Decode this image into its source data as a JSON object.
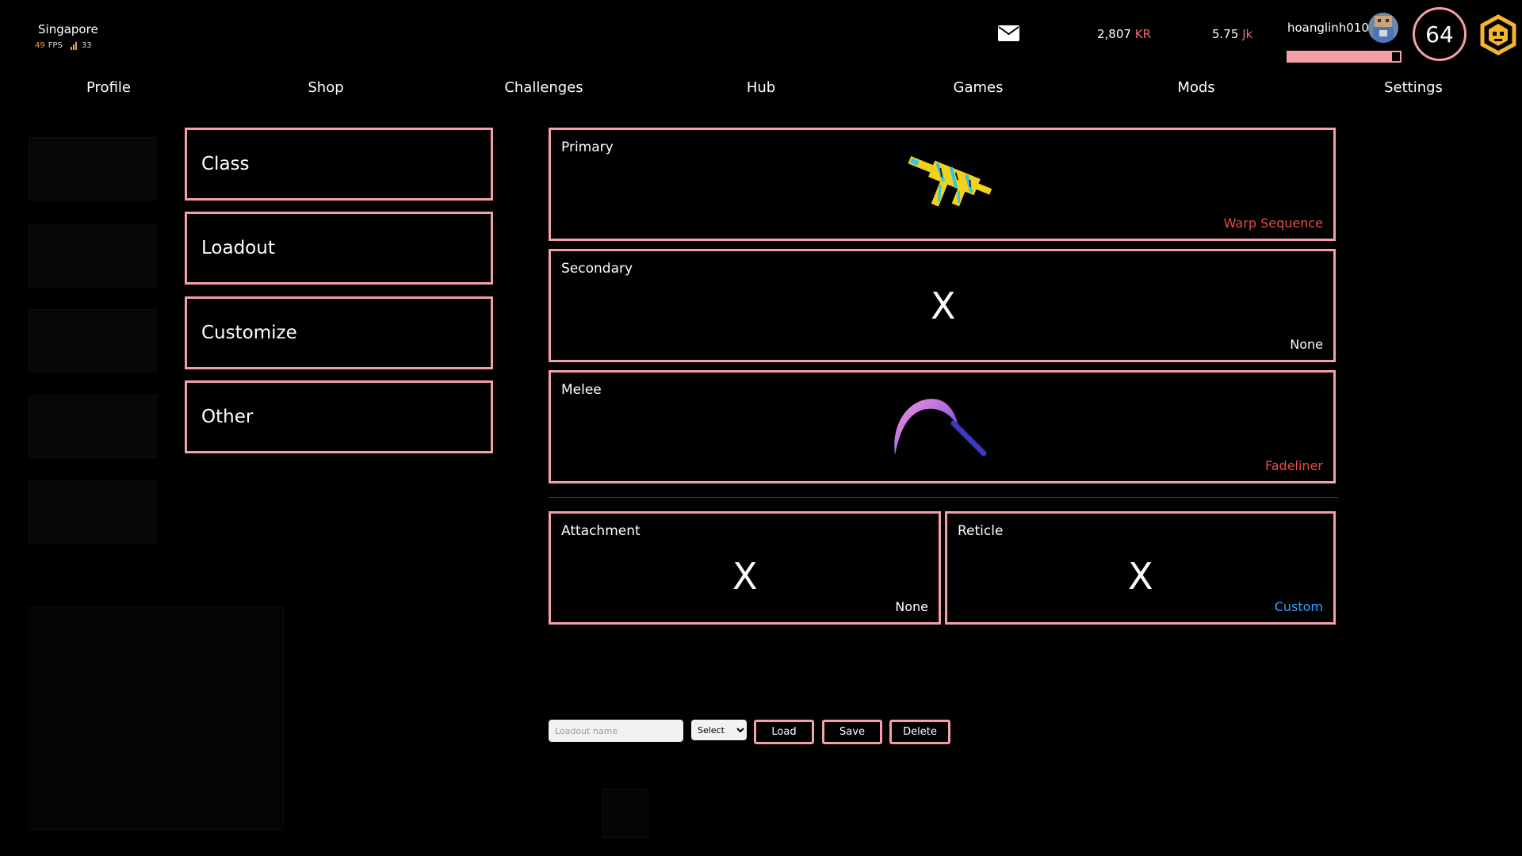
{
  "status": {
    "region": "Singapore",
    "fps": "49",
    "fps_label": "FPS",
    "ping": "33"
  },
  "header": {
    "kr_amount": "2,807",
    "kr_unit": "KR",
    "jk_amount": "5.75",
    "jk_unit": "Jk",
    "username": "hoanglinh0109",
    "level": "64",
    "xp_progress": 0.93
  },
  "nav": [
    "Profile",
    "Shop",
    "Challenges",
    "Hub",
    "Games",
    "Mods",
    "Settings"
  ],
  "menu": [
    "Class",
    "Loadout",
    "Customize",
    "Other"
  ],
  "slots": {
    "primary": {
      "label": "Primary",
      "item": "Warp Sequence",
      "item_color": "#e84a4a"
    },
    "secondary": {
      "label": "Secondary",
      "item": "None",
      "empty_mark": "X",
      "item_color": "#ffffff"
    },
    "melee": {
      "label": "Melee",
      "item": "Fadeliner",
      "item_color": "#e84a4a"
    },
    "attachment": {
      "label": "Attachment",
      "item": "None",
      "empty_mark": "X",
      "item_color": "#ffffff"
    },
    "reticle": {
      "label": "Reticle",
      "item": "Custom",
      "empty_mark": "X",
      "item_color": "#3aa0ff"
    }
  },
  "controls": {
    "loadout_placeholder": "Loadout name",
    "select_value": "Select",
    "load": "Load",
    "save": "Save",
    "delete": "Delete"
  },
  "colors": {
    "accent_border": "#f5a0a8",
    "currency_unit": "#f06a6a",
    "fps_number": "#f0a040",
    "badge": "#f5b52e"
  },
  "icons": [
    "mail-icon",
    "signal-icon",
    "avatar",
    "rank-badge-icon",
    "gun-icon",
    "scythe-icon"
  ]
}
